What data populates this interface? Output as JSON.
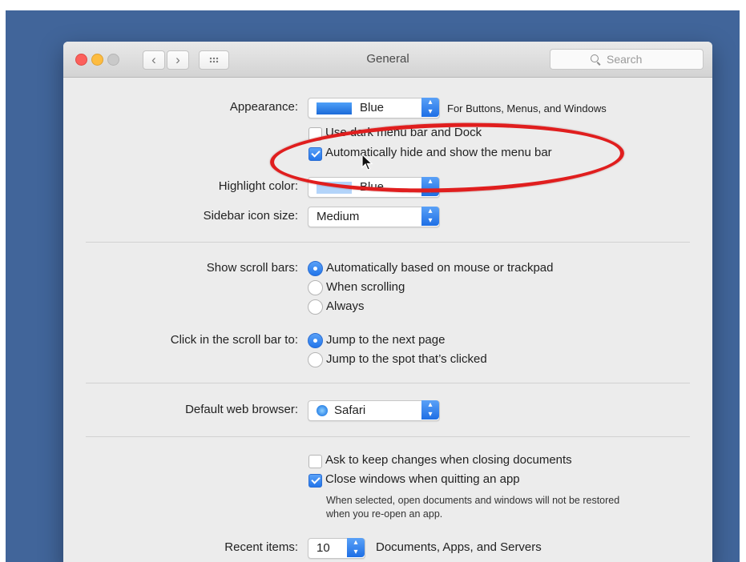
{
  "window": {
    "title": "General",
    "search_placeholder": "Search",
    "nav_back": "‹",
    "nav_forward": "›"
  },
  "appearance": {
    "label": "Appearance:",
    "value": "Blue",
    "side_text": "For Buttons, Menus, and Windows"
  },
  "menu_options": [
    {
      "label": "Use dark menu bar and Dock",
      "checked": false
    },
    {
      "label": "Automatically hide and show the menu bar",
      "checked": true
    }
  ],
  "highlight_color": {
    "label": "Highlight color:",
    "value": "Blue"
  },
  "sidebar_icon_size": {
    "label": "Sidebar icon size:",
    "value": "Medium"
  },
  "show_scroll_bars": {
    "label": "Show scroll bars:",
    "options": [
      "Automatically based on mouse or trackpad",
      "When scrolling",
      "Always"
    ],
    "selected": 0
  },
  "click_scroll_bar": {
    "label": "Click in the scroll bar to:",
    "options": [
      "Jump to the next page",
      "Jump to the spot that’s clicked"
    ],
    "selected": 0
  },
  "default_browser": {
    "label": "Default web browser:",
    "value": "Safari"
  },
  "document_options": [
    {
      "label": "Ask to keep changes when closing documents",
      "checked": false
    },
    {
      "label": "Close windows when quitting an app",
      "checked": true
    }
  ],
  "close_note": {
    "line1": "When selected, open documents and windows will not be restored",
    "line2": "when you re-open an app."
  },
  "recent_items": {
    "label": "Recent items:",
    "value": "10",
    "side_text": "Documents, Apps, and Servers"
  },
  "colors": {
    "accent": "#2275ea",
    "desktop": "#41659a",
    "annotation": "#e01e1e"
  }
}
